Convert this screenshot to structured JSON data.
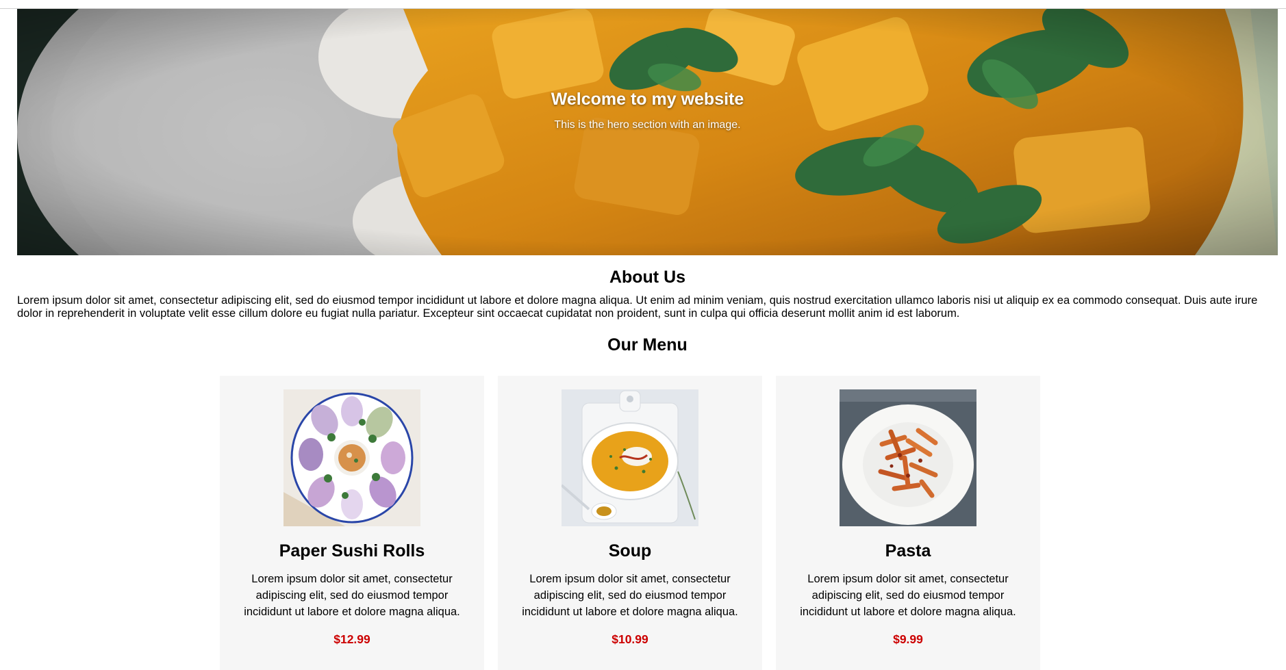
{
  "hero": {
    "title": "Welcome to my website",
    "subtitle": "This is the hero section with an image.",
    "image": "curry-dish-image"
  },
  "about": {
    "heading": "About Us",
    "text": "Lorem ipsum dolor sit amet, consectetur adipiscing elit, sed do eiusmod tempor incididunt ut labore et dolore magna aliqua. Ut enim ad minim veniam, quis nostrud exercitation ullamco laboris nisi ut aliquip ex ea commodo consequat. Duis aute irure dolor in reprehenderit in voluptate velit esse cillum dolore eu fugiat nulla pariatur. Excepteur sint occaecat cupidatat non proident, sunt in culpa qui officia deserunt mollit anim id est laborum."
  },
  "menu": {
    "heading": "Our Menu",
    "items": [
      {
        "name": "Paper Sushi Rolls",
        "description": "Lorem ipsum dolor sit amet, consectetur adipiscing elit, sed do eiusmod tempor incididunt ut labore et dolore magna aliqua.",
        "price": "$12.99",
        "image": "spring-rolls-image"
      },
      {
        "name": "Soup",
        "description": "Lorem ipsum dolor sit amet, consectetur adipiscing elit, sed do eiusmod tempor incididunt ut labore et dolore magna aliqua.",
        "price": "$10.99",
        "image": "soup-bowl-image"
      },
      {
        "name": "Pasta",
        "description": "Lorem ipsum dolor sit amet, consectetur adipiscing elit, sed do eiusmod tempor incididunt ut labore et dolore magna aliqua.",
        "price": "$9.99",
        "image": "pasta-plate-image"
      }
    ]
  },
  "colors": {
    "price": "#cc0000",
    "card_bg": "#f6f6f6",
    "hero_text": "#ffffff"
  }
}
